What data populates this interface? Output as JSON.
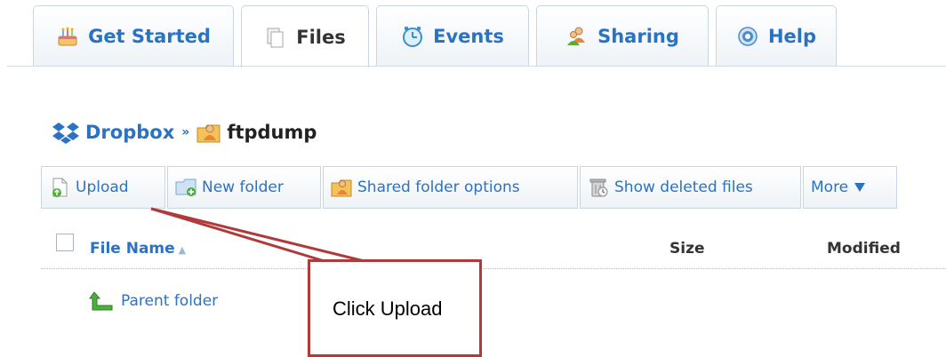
{
  "tabs": [
    {
      "label": "Get Started",
      "icon": "cake-icon",
      "active": false
    },
    {
      "label": "Files",
      "icon": "files-icon",
      "active": true
    },
    {
      "label": "Events",
      "icon": "clock-icon",
      "active": false
    },
    {
      "label": "Sharing",
      "icon": "people-icon",
      "active": false
    },
    {
      "label": "Help",
      "icon": "help-icon",
      "active": false
    }
  ],
  "breadcrumb": {
    "root": "Dropbox",
    "separator": "»",
    "current": "ftpdump"
  },
  "toolbar": {
    "upload": "Upload",
    "new_folder": "New folder",
    "shared_folder_options": "Shared folder options",
    "show_deleted_files": "Show deleted files",
    "more": "More"
  },
  "list_header": {
    "file_name": "File Name",
    "size": "Size",
    "modified": "Modified"
  },
  "rows": {
    "parent_folder": "Parent folder"
  },
  "annotation": {
    "text": "Click Upload"
  },
  "colors": {
    "link": "#2a72c4",
    "callout_border": "#b03a3a",
    "tab_border": "#c7d6e2"
  }
}
